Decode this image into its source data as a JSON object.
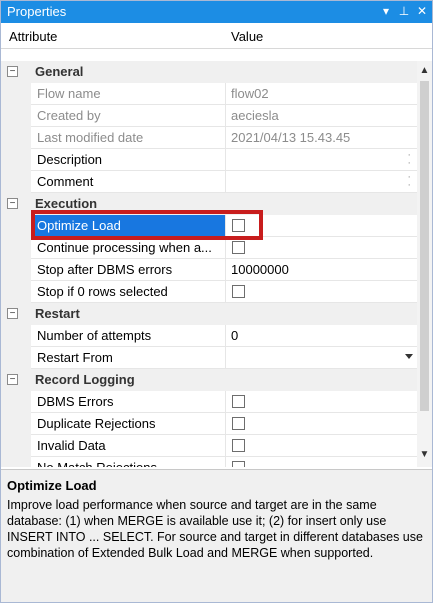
{
  "window": {
    "title": "Properties",
    "buttons": [
      "▾",
      "⊥",
      "✕"
    ]
  },
  "columns": {
    "attribute": "Attribute",
    "value": "Value"
  },
  "categories": {
    "general": "General",
    "execution": "Execution",
    "restart": "Restart",
    "record_logging": "Record Logging"
  },
  "rows": {
    "flow_name": {
      "name": "Flow name",
      "value": "flow02"
    },
    "created_by": {
      "name": "Created by",
      "value": "aeciesla"
    },
    "last_modified": {
      "name": "Last modified date",
      "value": "2021/04/13 15.43.45"
    },
    "description": {
      "name": "Description",
      "value": ""
    },
    "comment": {
      "name": "Comment",
      "value": ""
    },
    "optimize_load": {
      "name": "Optimize Load",
      "checked": false
    },
    "continue_processing": {
      "name": "Continue processing when a...",
      "checked": false
    },
    "stop_after_dbms": {
      "name": "Stop after DBMS errors",
      "value": "10000000"
    },
    "stop_if_zero": {
      "name": "Stop if 0 rows selected",
      "checked": false
    },
    "number_of_attempts": {
      "name": "Number of attempts",
      "value": "0"
    },
    "restart_from": {
      "name": "Restart From",
      "value": ""
    },
    "dbms_errors": {
      "name": "DBMS Errors",
      "checked": false
    },
    "duplicate_rejections": {
      "name": "Duplicate Rejections",
      "checked": false
    },
    "invalid_data": {
      "name": "Invalid Data",
      "checked": false
    },
    "no_match_rejections": {
      "name": "No Match Rejections",
      "checked": false
    }
  },
  "description_panel": {
    "title": "Optimize Load",
    "text": "Improve load performance when source and target are in the same database: (1) when MERGE is available use it; (2) for insert only use INSERT INTO ... SELECT. For source and target in different databases use combination of Extended Bulk Load and MERGE when supported."
  },
  "colors": {
    "titlebar": "#1c8de4",
    "selection": "#1877e0",
    "highlight_box": "#c81d1d"
  }
}
